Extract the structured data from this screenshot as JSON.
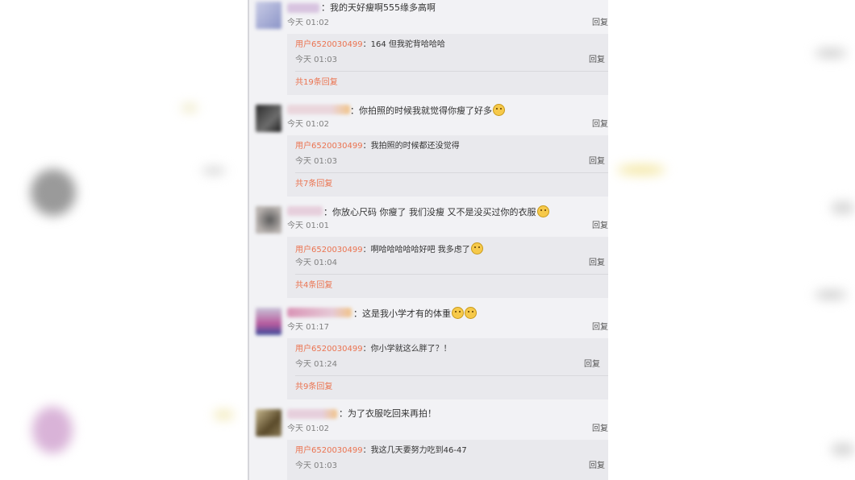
{
  "comments": [
    {
      "name_suffix": "：",
      "text": "我的天好瘦啊555缘多高啊",
      "time": "今天 01:02",
      "reply_label": "回复",
      "emoji_count": 0,
      "sub": {
        "user": "用户6520030499",
        "sep": "：",
        "text": "164 但我驼背哈哈哈",
        "time": "今天 01:03",
        "reply_label": "回复",
        "more": "共19条回复"
      }
    },
    {
      "name_suffix": "：",
      "text": "你拍照的时候我就觉得你瘦了好多",
      "time": "今天 01:02",
      "reply_label": "回复",
      "emoji_count": 1,
      "sub": {
        "user": "用户6520030499",
        "sep": "：",
        "text": "我拍照的时候都还没觉得",
        "time": "今天 01:03",
        "reply_label": "回复",
        "more": "共7条回复"
      }
    },
    {
      "name_suffix": "：",
      "text": "你放心尺码 你瘦了 我们没瘦 又不是没买过你的衣服",
      "time": "今天 01:01",
      "reply_label": "回复",
      "emoji_count": 1,
      "sub": {
        "user": "用户6520030499",
        "sep": "：",
        "text": "啊哈哈哈哈哈好吧 我多虑了",
        "time": "今天 01:04",
        "reply_label": "回复",
        "more": "共4条回复"
      }
    },
    {
      "name_suffix": "：",
      "text": "这是我小学才有的体重",
      "time": "今天 01:17",
      "reply_label": "回复",
      "emoji_count": 2,
      "sub": {
        "user": "用户6520030499",
        "sep": "：",
        "text": "你小学就这么胖了？！",
        "time": "今天 01:24",
        "reply_label": "回复",
        "more": "共9条回复"
      }
    },
    {
      "name_suffix": "：",
      "text": "为了衣服吃回来再拍！",
      "time": "今天 01:02",
      "reply_label": "回复",
      "emoji_count": 0,
      "sub": {
        "user": "用户6520030499",
        "sep": "：",
        "text": "我这几天要努力吃到46-47",
        "time": "今天 01:03",
        "reply_label": "回复",
        "more": ""
      }
    }
  ],
  "colors": {
    "link": "#eb7350",
    "panel_bg": "#f2f2f5",
    "sub_bg": "#e9e9ed"
  }
}
